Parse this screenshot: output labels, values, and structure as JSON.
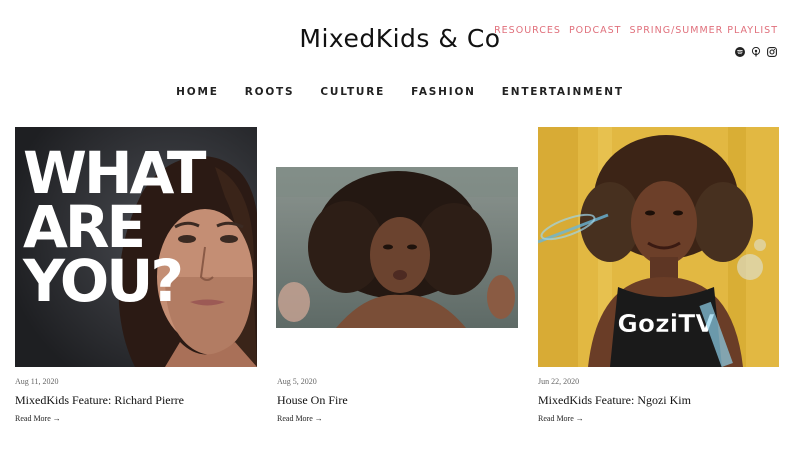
{
  "site": {
    "brand": "MixedKids & Co"
  },
  "top_links": [
    "RESOURCES",
    "PODCAST",
    "SPRING/SUMMER PLAYLIST"
  ],
  "socials": [
    {
      "icon": "spotify-icon"
    },
    {
      "icon": "podcast-icon"
    },
    {
      "icon": "instagram-icon"
    }
  ],
  "nav": [
    "HOME",
    "ROOTS",
    "CULTURE",
    "FASHION",
    "ENTERTAINMENT"
  ],
  "posts": [
    {
      "date": "Aug 11, 2020",
      "title": "MixedKids Feature: Richard Pierre",
      "read_more": "Read More →",
      "image_text": [
        "WHAT",
        "ARE",
        "YOU?"
      ]
    },
    {
      "date": "Aug 5, 2020",
      "title": "House On Fire",
      "read_more": "Read More →"
    },
    {
      "date": "Jun 22, 2020",
      "title": "MixedKids Feature: Ngozi Kim",
      "read_more": "Read More →",
      "shirt_text": "GoziTV"
    }
  ],
  "colors": {
    "accent": "#e0707c",
    "text": "#111111"
  }
}
